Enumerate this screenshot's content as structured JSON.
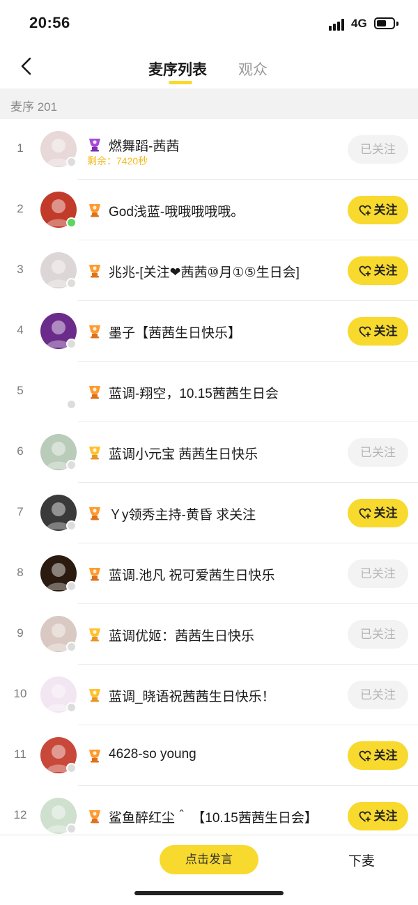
{
  "status_bar": {
    "time": "20:56",
    "network": "4G",
    "battery_level": 0.6
  },
  "header": {
    "tab_active": "麦序列表",
    "tab_inactive": "观众"
  },
  "section": {
    "label": "麦序 201"
  },
  "list": [
    {
      "rank": "1",
      "name": "燃舞蹈-茜茜",
      "sub": "剩余：7420秒",
      "badge": "purple",
      "follow": "已关注",
      "followed": true,
      "online": false,
      "avatar_color": "#e8d8d8"
    },
    {
      "rank": "2",
      "name": "God浅蓝-哦哦哦哦哦。",
      "badge": "orange",
      "follow": "关注",
      "followed": false,
      "online": true,
      "avatar_color": "#c23a2a"
    },
    {
      "rank": "3",
      "name": "兆兆-[关注❤茜茜⑩月①⑤生日会]",
      "badge": "orange",
      "follow": "关注",
      "followed": false,
      "online": false,
      "avatar_color": "#ddd6d6"
    },
    {
      "rank": "4",
      "name": "墨子【茜茜生日快乐】",
      "badge": "orange",
      "follow": "关注",
      "followed": false,
      "online": false,
      "avatar_color": "#6b2b8a"
    },
    {
      "rank": "5",
      "name": "蓝调-翔空，10.15茜茜生日会",
      "badge": "orange",
      "online": false,
      "avatar_color": "#ffffff"
    },
    {
      "rank": "6",
      "name": "蓝调小元宝 茜茜生日快乐",
      "badge": "gold",
      "follow": "已关注",
      "followed": true,
      "online": false,
      "avatar_color": "#b9cbb9"
    },
    {
      "rank": "7",
      "name": "Ｙy领秀主持-黄昏  求关注",
      "badge": "orange",
      "follow": "关注",
      "followed": false,
      "online": false,
      "avatar_color": "#3a3a3a"
    },
    {
      "rank": "8",
      "name": "蓝调.池凡 祝可爱茜生日快乐",
      "badge": "orange",
      "follow": "已关注",
      "followed": true,
      "online": false,
      "avatar_color": "#2a1a10"
    },
    {
      "rank": "9",
      "name": "蓝调优姬：茜茜生日快乐",
      "badge": "gold",
      "follow": "已关注",
      "followed": true,
      "online": false,
      "avatar_color": "#d9c9c2"
    },
    {
      "rank": "10",
      "name": "蓝调_晓语祝茜茜生日快乐！",
      "badge": "gold",
      "follow": "已关注",
      "followed": true,
      "online": false,
      "avatar_color": "#f1e6f1"
    },
    {
      "rank": "11",
      "name": "4628-so   young",
      "badge": "orange",
      "follow": "关注",
      "followed": false,
      "online": false,
      "avatar_color": "#c8483a"
    },
    {
      "rank": "12",
      "name": "鲨鱼醉红尘＾ 【10.15茜茜生日会】",
      "badge": "orange",
      "follow": "关注",
      "followed": false,
      "online": false,
      "avatar_color": "#cfe0cf"
    }
  ],
  "bottom": {
    "speak_label": "点击发言",
    "leave_label": "下麦"
  },
  "colors": {
    "accent": "#f8d92e",
    "sub_text": "#f5b921",
    "online": "#5cd65c",
    "offline": "#dddddd"
  },
  "icons": {
    "back": "chevron-left-icon",
    "follow": "heart-plus-icon",
    "level": "trophy-icon"
  }
}
